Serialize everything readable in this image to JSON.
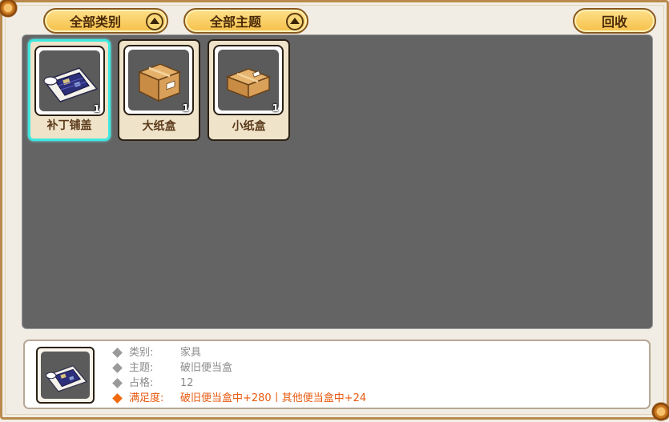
{
  "toolbar": {
    "category_label": "全部类别",
    "theme_label": "全部主题",
    "recycle_label": "回收"
  },
  "items": [
    {
      "name": "补丁铺盖",
      "count": "1",
      "icon": "patched-bedding-icon",
      "selected": true
    },
    {
      "name": "大纸盒",
      "count": "1",
      "icon": "large-cardboard-box-icon",
      "selected": false
    },
    {
      "name": "小纸盒",
      "count": "1",
      "icon": "small-cardboard-box-icon",
      "selected": false
    }
  ],
  "info": {
    "icon": "patched-bedding-icon",
    "category_key": "类别:",
    "category_val": "家具",
    "theme_key": "主题:",
    "theme_val": "破旧便当盒",
    "space_key": "占格:",
    "space_val": "12",
    "satisfaction_key": "满足度:",
    "satisfaction_val": "破旧便当盒中+280丨其他便当盒中+24"
  },
  "colors": {
    "selected_border": "#3ee8df",
    "highlight_text": "#e85a10",
    "button_fill": "#f5c048",
    "panel_bg": "#646464"
  }
}
